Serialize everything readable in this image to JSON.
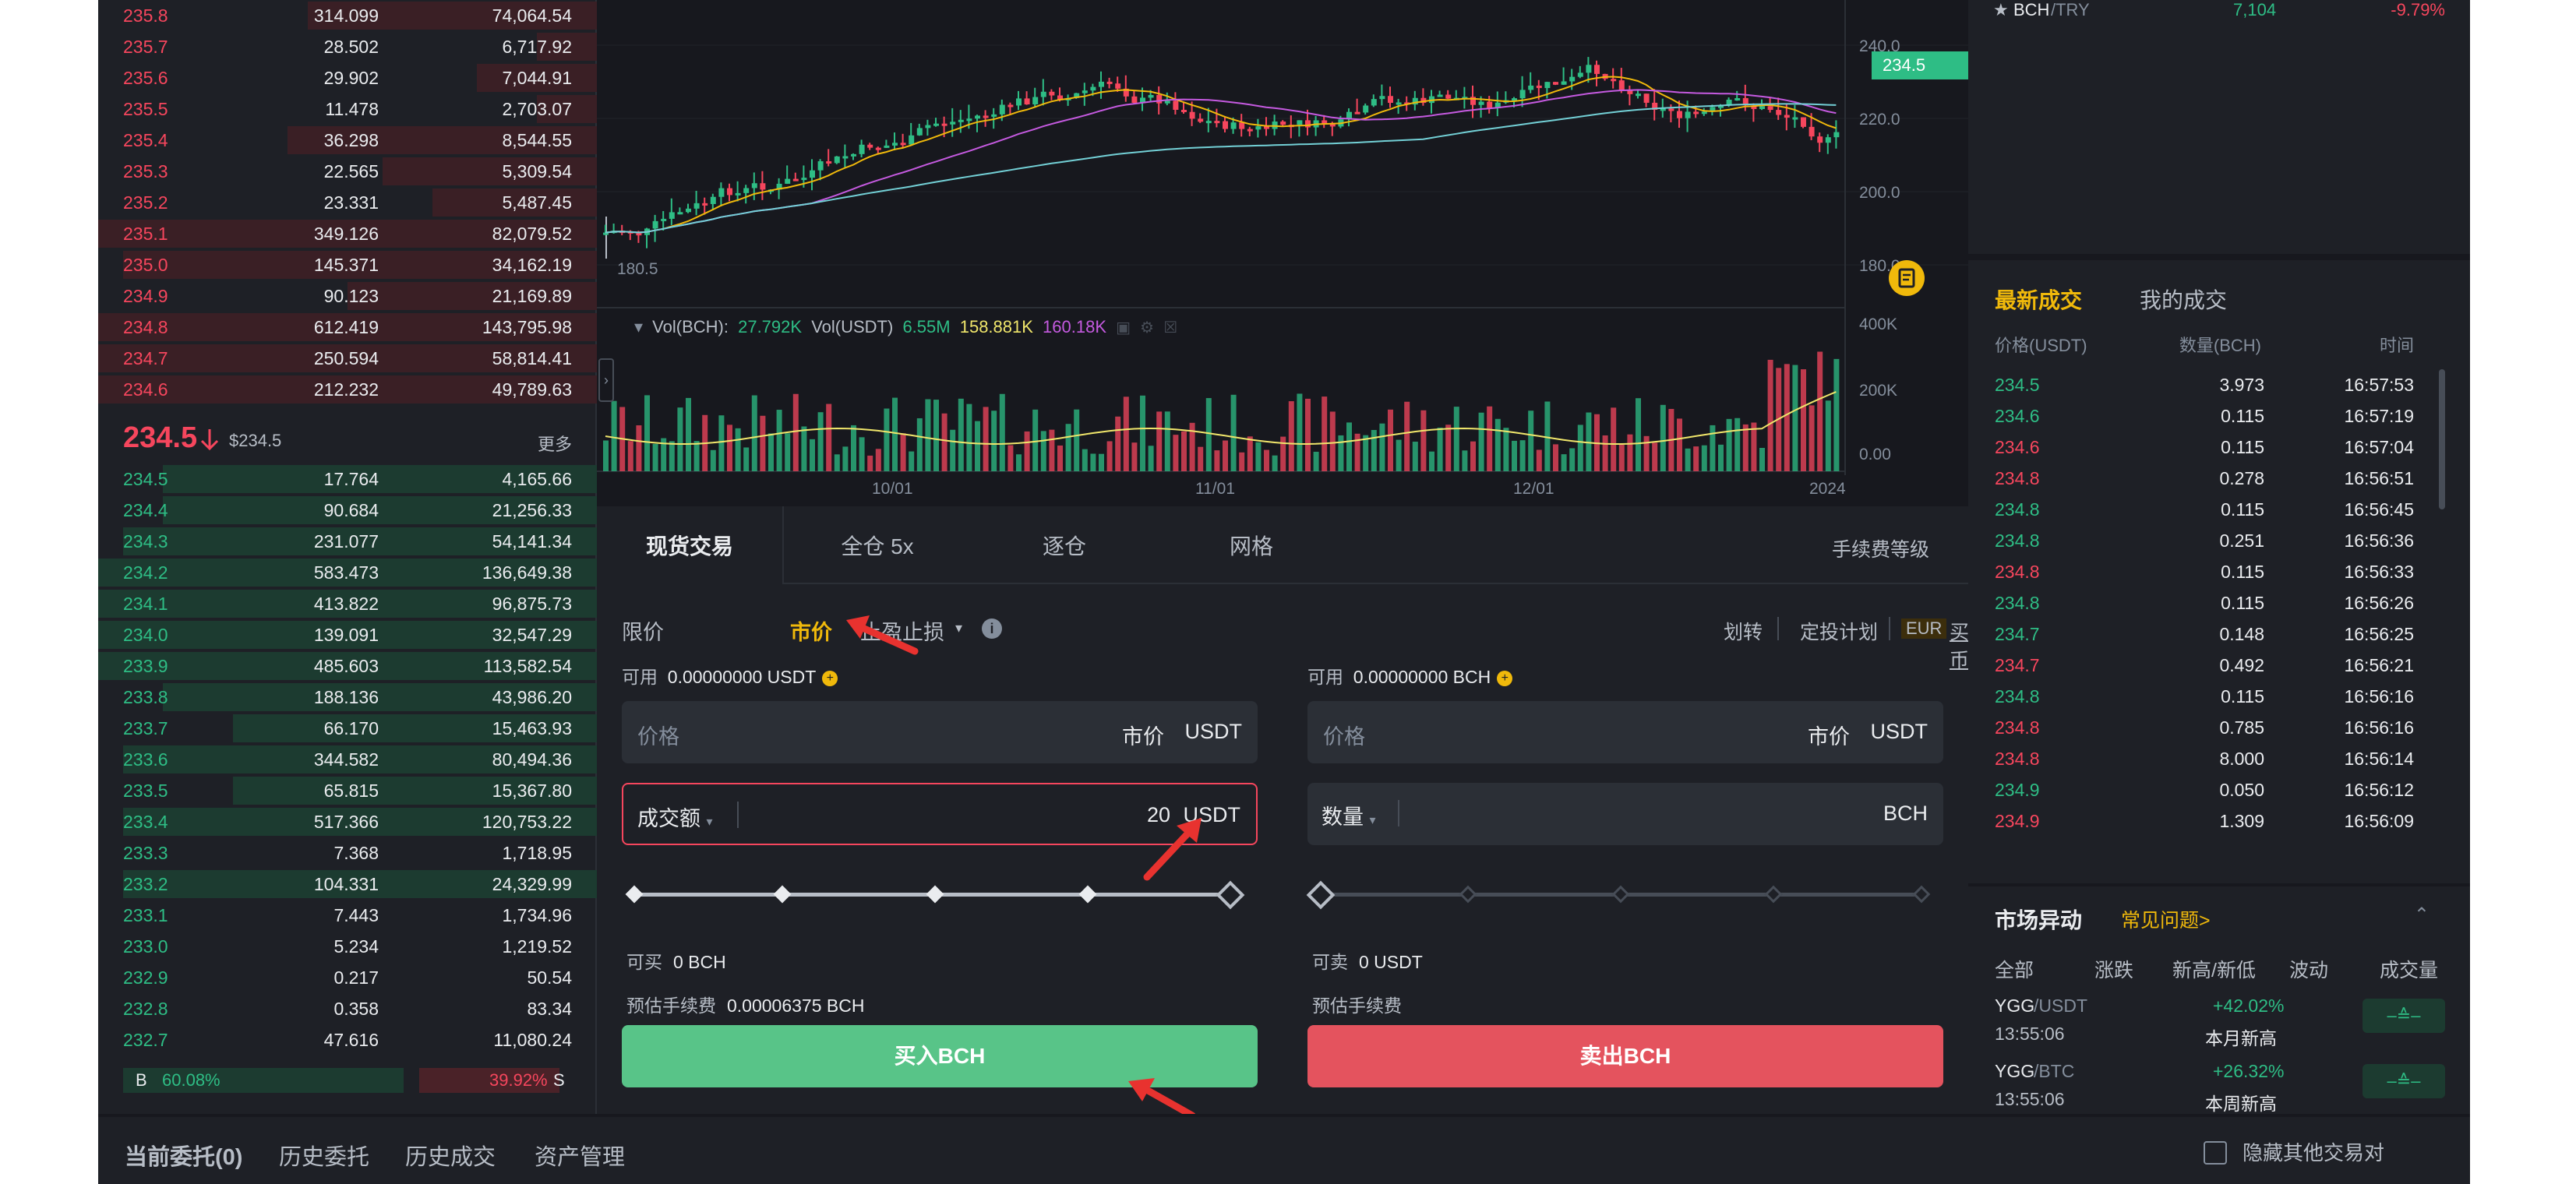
{
  "orderbook": {
    "asks": [
      {
        "p": "235.8",
        "q": "314.099",
        "t": "74,064.54",
        "d": 0.58
      },
      {
        "p": "235.7",
        "q": "28.502",
        "t": "6,717.92",
        "d": 0.12
      },
      {
        "p": "235.6",
        "q": "29.902",
        "t": "7,044.91",
        "d": 0.24
      },
      {
        "p": "235.5",
        "q": "11.478",
        "t": "2,703.07",
        "d": 0.12
      },
      {
        "p": "235.4",
        "q": "36.298",
        "t": "8,544.55",
        "d": 0.62
      },
      {
        "p": "235.3",
        "q": "22.565",
        "t": "5,309.54",
        "d": 0.43
      },
      {
        "p": "235.2",
        "q": "23.331",
        "t": "5,487.45",
        "d": 0.33
      },
      {
        "p": "235.1",
        "q": "349.126",
        "t": "82,079.52",
        "d": 1.0
      },
      {
        "p": "235.0",
        "q": "145.371",
        "t": "34,162.19",
        "d": 0.95
      },
      {
        "p": "234.9",
        "q": "90.123",
        "t": "21,169.89",
        "d": 0.5
      },
      {
        "p": "234.8",
        "q": "612.419",
        "t": "143,795.98",
        "d": 1.0
      },
      {
        "p": "234.7",
        "q": "250.594",
        "t": "58,814.41",
        "d": 1.0
      },
      {
        "p": "234.6",
        "q": "212.232",
        "t": "49,789.63",
        "d": 1.0
      }
    ],
    "last_price": "234.5",
    "last_usd": "$234.5",
    "more": "更多",
    "bids": [
      {
        "p": "234.5",
        "q": "17.764",
        "t": "4,165.66",
        "d": 0.87
      },
      {
        "p": "234.4",
        "q": "90.684",
        "t": "21,256.33",
        "d": 0.87
      },
      {
        "p": "234.3",
        "q": "231.077",
        "t": "54,141.34",
        "d": 0.95
      },
      {
        "p": "234.2",
        "q": "583.473",
        "t": "136,649.38",
        "d": 1.0
      },
      {
        "p": "234.1",
        "q": "413.822",
        "t": "96,875.73",
        "d": 1.0
      },
      {
        "p": "234.0",
        "q": "139.091",
        "t": "32,547.29",
        "d": 1.0
      },
      {
        "p": "233.9",
        "q": "485.603",
        "t": "113,582.54",
        "d": 1.0
      },
      {
        "p": "233.8",
        "q": "188.136",
        "t": "43,986.20",
        "d": 0.87
      },
      {
        "p": "233.7",
        "q": "66.170",
        "t": "15,463.93",
        "d": 0.73
      },
      {
        "p": "233.6",
        "q": "344.582",
        "t": "80,494.36",
        "d": 0.95
      },
      {
        "p": "233.5",
        "q": "65.815",
        "t": "15,367.80",
        "d": 0.73
      },
      {
        "p": "233.4",
        "q": "517.366",
        "t": "120,753.22",
        "d": 0.95
      },
      {
        "p": "233.3",
        "q": "7.368",
        "t": "1,718.95",
        "d": 0.0
      },
      {
        "p": "233.2",
        "q": "104.331",
        "t": "24,329.99",
        "d": 0.95
      },
      {
        "p": "233.1",
        "q": "7.443",
        "t": "1,734.96",
        "d": 0.0
      },
      {
        "p": "233.0",
        "q": "5.234",
        "t": "1,219.52",
        "d": 0.0
      },
      {
        "p": "232.9",
        "q": "0.217",
        "t": "50.54",
        "d": 0.0
      },
      {
        "p": "232.8",
        "q": "0.358",
        "t": "83.34",
        "d": 0.0
      },
      {
        "p": "232.7",
        "q": "47.616",
        "t": "11,080.24",
        "d": 0.0
      }
    ],
    "buy_label": "B",
    "buy_ratio": "60.08%",
    "sell_ratio": "39.92%",
    "sell_label": "S"
  },
  "chart": {
    "price_axis": [
      "240.0",
      "220.0",
      "200.0",
      "180.0"
    ],
    "low_label": "180.5",
    "price_badge": "234.5",
    "vol_axis": [
      "400K",
      "200K",
      "0.00"
    ],
    "date_axis": [
      "10/01",
      "11/01",
      "12/01",
      "2024"
    ],
    "vol_label1": "Vol(BCH):",
    "vol_val1": "27.792K",
    "vol_label2": "Vol(USDT)",
    "vol_val2": "6.55M",
    "vol_val3": "158.881K",
    "vol_val4": "160.18K",
    "colors": {
      "up": "#2ebd85",
      "down": "#f6465d",
      "ma7": "#f0b90b",
      "ma25": "#c55ae0",
      "ma99": "#73d0d6"
    }
  },
  "trade": {
    "tabs": [
      "现货交易",
      "全仓 5x",
      "逐仓",
      "网格"
    ],
    "fee_level": "手续费等级",
    "order_types": {
      "limit": "限价",
      "market": "市价",
      "stop": "止盈止损"
    },
    "links": {
      "transfer": "划转",
      "dca": "定投计划",
      "eur": "EUR",
      "buy": "买币"
    },
    "buy": {
      "avail_label": "可用",
      "avail_val": "0.00000000 USDT",
      "price_ph": "价格",
      "price_mode": "市价",
      "price_unit": "USDT",
      "amt_mode": "成交额",
      "amt_val": "20",
      "amt_unit": "USDT",
      "can_label": "可买",
      "can_val": "0 BCH",
      "fee_label": "预估手续费",
      "fee_val": "0.00006375 BCH",
      "button": "买入BCH"
    },
    "sell": {
      "avail_label": "可用",
      "avail_val": "0.00000000 BCH",
      "price_ph": "价格",
      "price_mode": "市价",
      "price_unit": "USDT",
      "amt_mode": "数量",
      "amt_unit": "BCH",
      "can_label": "可卖",
      "can_val": "0 USDT",
      "fee_label": "预估手续费",
      "button": "卖出BCH"
    }
  },
  "market_top": {
    "pair_base": "BCH",
    "pair_quote": "/TRY",
    "price": "7,104",
    "change": "-9.79%"
  },
  "trades": {
    "tab_latest": "最新成交",
    "tab_mine": "我的成交",
    "h_price": "价格(USDT)",
    "h_qty": "数量(BCH)",
    "h_time": "时间",
    "rows": [
      {
        "p": "234.5",
        "q": "3.973",
        "t": "16:57:53",
        "s": "up"
      },
      {
        "p": "234.6",
        "q": "0.115",
        "t": "16:57:19",
        "s": "up"
      },
      {
        "p": "234.6",
        "q": "0.115",
        "t": "16:57:04",
        "s": "dn"
      },
      {
        "p": "234.8",
        "q": "0.278",
        "t": "16:56:51",
        "s": "dn"
      },
      {
        "p": "234.8",
        "q": "0.115",
        "t": "16:56:45",
        "s": "up"
      },
      {
        "p": "234.8",
        "q": "0.251",
        "t": "16:56:36",
        "s": "up"
      },
      {
        "p": "234.8",
        "q": "0.115",
        "t": "16:56:33",
        "s": "dn"
      },
      {
        "p": "234.8",
        "q": "0.115",
        "t": "16:56:26",
        "s": "up"
      },
      {
        "p": "234.7",
        "q": "0.148",
        "t": "16:56:25",
        "s": "up"
      },
      {
        "p": "234.7",
        "q": "0.492",
        "t": "16:56:21",
        "s": "dn"
      },
      {
        "p": "234.8",
        "q": "0.115",
        "t": "16:56:16",
        "s": "up"
      },
      {
        "p": "234.8",
        "q": "0.785",
        "t": "16:56:16",
        "s": "dn"
      },
      {
        "p": "234.8",
        "q": "8.000",
        "t": "16:56:14",
        "s": "dn"
      },
      {
        "p": "234.9",
        "q": "0.050",
        "t": "16:56:12",
        "s": "up"
      },
      {
        "p": "234.9",
        "q": "1.309",
        "t": "16:56:09",
        "s": "dn"
      }
    ]
  },
  "anomaly": {
    "title": "市场异动",
    "faq": "常见问题>",
    "tabs": [
      "全部",
      "涨跌",
      "新高/新低",
      "波动",
      "成交量"
    ],
    "rows": [
      {
        "base": "YGG",
        "quote": "/USDT",
        "change": "+42.02%",
        "time": "13:55:06",
        "desc": "本月新高"
      },
      {
        "base": "YGG",
        "quote": "/BTC",
        "change": "+26.32%",
        "time": "13:55:06",
        "desc": "本周新高"
      }
    ]
  },
  "bottom": {
    "tabs": [
      "当前委托(0)",
      "历史委托",
      "历史成交",
      "资产管理"
    ],
    "hide_label": "隐藏其他交易对"
  }
}
